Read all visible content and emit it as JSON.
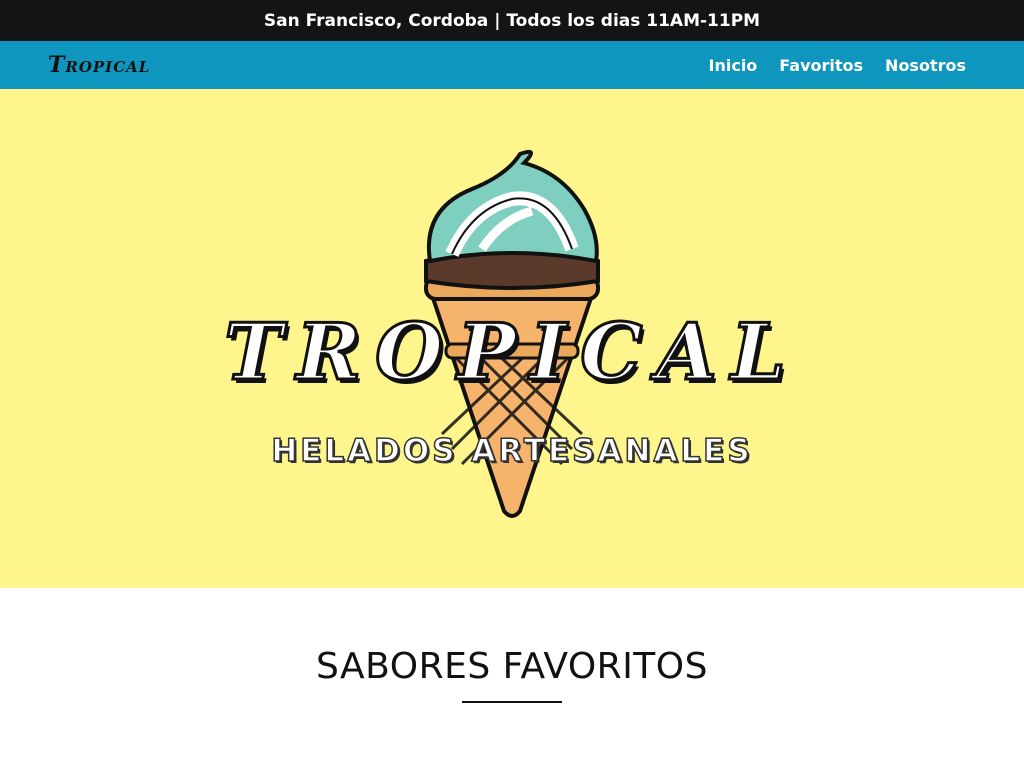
{
  "topbar": {
    "text": "San Francisco, Cordoba | Todos los dias 11AM-11PM"
  },
  "navbar": {
    "brand": "Tropical",
    "links": [
      {
        "label": "Inicio"
      },
      {
        "label": "Favoritos"
      },
      {
        "label": "Nosotros"
      }
    ]
  },
  "hero": {
    "background_color": "#fef68d",
    "title": "TROPICAL",
    "subtitle": "HELADOS ARTESANALES",
    "image": "ice-cream-cone-illustration"
  },
  "section": {
    "title": "SABORES FAVORITOS"
  },
  "colors": {
    "topbar": "#141414",
    "navbar": "#0f96bf",
    "accent": "#7ecfc0"
  }
}
